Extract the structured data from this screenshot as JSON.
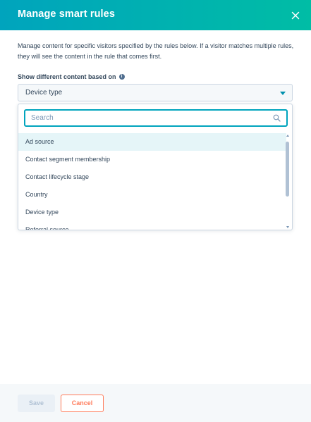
{
  "modal": {
    "title": "Manage smart rules",
    "description": "Manage content for specific visitors specified by the rules below. If a visitor matches multiple rules, they will see the content in the rule that comes first."
  },
  "field": {
    "label": "Show different content based on",
    "selected_value": "Device type"
  },
  "dropdown": {
    "search_placeholder": "Search",
    "options": [
      "Ad source",
      "Contact segment membership",
      "Contact lifecycle stage",
      "Country",
      "Device type",
      "Referral source"
    ],
    "highlighted_option": "Ad source"
  },
  "footer": {
    "save_label": "Save",
    "cancel_label": "Cancel"
  },
  "colors": {
    "header_gradient_start": "#00a4bd",
    "header_gradient_end": "#00bda5",
    "accent_orange": "#ff7a59",
    "focus_teal": "#00a4bd",
    "text_dark": "#33475b"
  },
  "icons": {
    "close": "close-icon",
    "info": "info-icon",
    "caret": "caret-down-icon",
    "search": "search-icon"
  }
}
